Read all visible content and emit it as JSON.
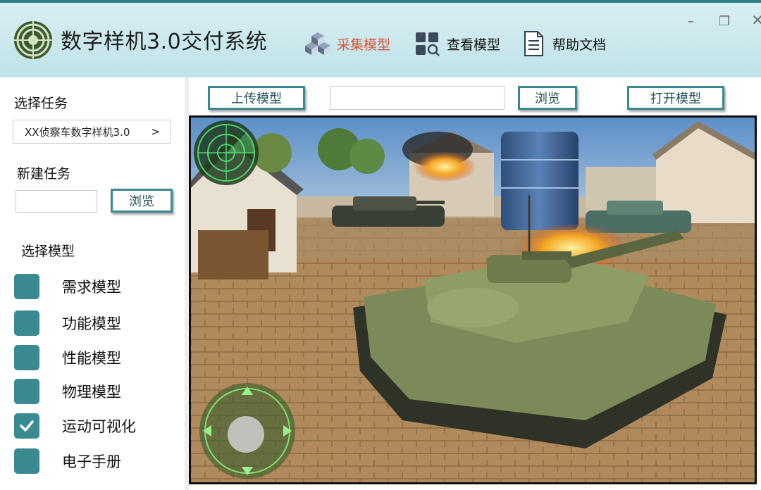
{
  "header": {
    "app_title": "数字样机3.0交付系统",
    "nav": [
      {
        "label": "采集模型",
        "icon": "cubes-icon",
        "active": true
      },
      {
        "label": "查看模型",
        "icon": "grid-search-icon",
        "active": false
      },
      {
        "label": "帮助文档",
        "icon": "document-icon",
        "active": false
      }
    ],
    "window_controls": {
      "minimize": "–",
      "restore": "❐",
      "close": "×"
    }
  },
  "sidebar": {
    "select_task_label": "选择任务",
    "selected_task": "XX侦察车数字样机3.0",
    "selected_task_arrow": ">",
    "new_task_label": "新建任务",
    "new_task_input_value": "",
    "new_task_browse": "浏览",
    "select_model_label": "选择模型",
    "models": [
      {
        "label": "需求模型",
        "checked": false
      },
      {
        "label": "功能模型",
        "checked": false
      },
      {
        "label": "性能模型",
        "checked": false
      },
      {
        "label": "物理模型",
        "checked": false
      },
      {
        "label": "运动可视化",
        "checked": true
      },
      {
        "label": "电子手册",
        "checked": false
      }
    ]
  },
  "toolbar": {
    "upload_model": "上传模型",
    "path_value": "",
    "browse": "浏览",
    "open_model": "打开模型"
  },
  "colors": {
    "accent": "#3a8a92",
    "active_nav": "#d8553a",
    "header_bg": "#c9e8ec"
  }
}
